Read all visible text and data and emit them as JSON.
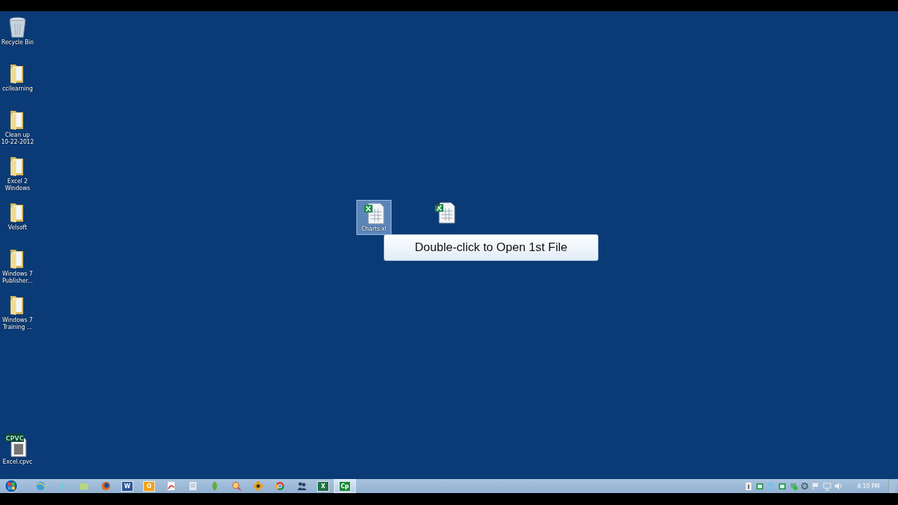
{
  "desktop_icons": [
    {
      "kind": "bin",
      "label": "Recycle Bin",
      "selected": false
    },
    {
      "kind": "folder",
      "label": "ccilearning",
      "selected": false
    },
    {
      "kind": "folder",
      "label": "Clean up 10-22-2012",
      "selected": false
    },
    {
      "kind": "folder",
      "label": "Excel 2 Windows",
      "selected": false
    },
    {
      "kind": "folder",
      "label": "Velsoft",
      "selected": false
    },
    {
      "kind": "folder",
      "label": "Windows 7 Publisher...",
      "selected": false
    },
    {
      "kind": "folder",
      "label": "Windows 7 Training ...",
      "selected": false
    },
    {
      "kind": "video",
      "label": "Excel.cpvc",
      "badge": "CPVC",
      "selected": false
    }
  ],
  "files": [
    {
      "kind": "sheet",
      "label": "Charts.xl",
      "selected": true
    },
    {
      "kind": "sheet-check",
      "selected": false
    }
  ],
  "tooltip": "Double-click to Open 1st File",
  "taskbar": {
    "buttons": [
      {
        "kind": "globe",
        "selected": false
      },
      {
        "kind": "star",
        "selected": false
      },
      {
        "kind": "folder",
        "selected": false
      },
      {
        "kind": "fox",
        "selected": false
      },
      {
        "kind": "letter",
        "glyph": "W",
        "color": "#2b5797",
        "selected": false
      },
      {
        "kind": "letter",
        "glyph": "O",
        "color": "#f2a01c",
        "selected": false
      },
      {
        "kind": "pdf",
        "selected": false
      },
      {
        "kind": "doc",
        "selected": false
      },
      {
        "kind": "leaf",
        "selected": false
      },
      {
        "kind": "magnifier",
        "selected": false
      },
      {
        "kind": "flower",
        "selected": false
      },
      {
        "kind": "chrome",
        "selected": false
      },
      {
        "kind": "people",
        "selected": false
      },
      {
        "kind": "letter",
        "glyph": "X",
        "color": "#1e7145",
        "selected": false
      },
      {
        "kind": "letter",
        "glyph": "Cp",
        "color": "#1c8a3c",
        "selected": true
      }
    ],
    "tray": [
      {
        "kind": "info"
      },
      {
        "kind": "green-box"
      },
      {
        "kind": "dropbox"
      },
      {
        "kind": "green-box"
      },
      {
        "kind": "shield"
      },
      {
        "kind": "gear"
      },
      {
        "kind": "flag"
      },
      {
        "kind": "network"
      },
      {
        "kind": "speaker"
      }
    ],
    "clock": "4:10 PM"
  }
}
